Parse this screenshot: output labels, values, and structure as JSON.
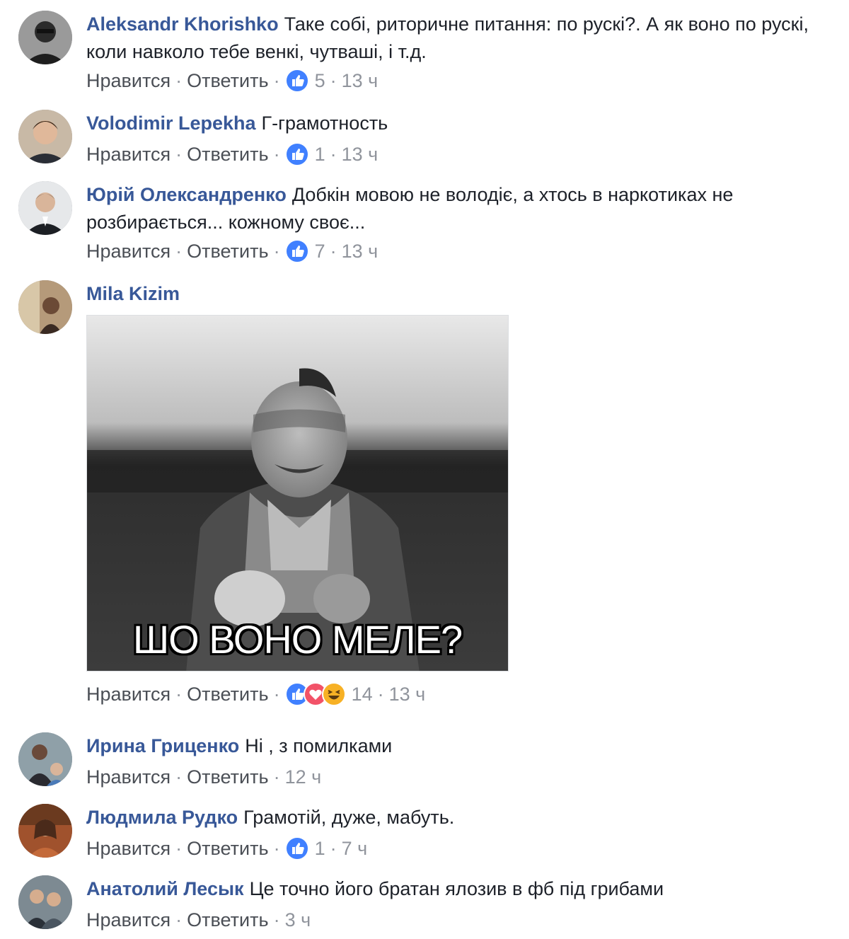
{
  "labels": {
    "like": "Нравится",
    "reply": "Ответить",
    "separator": "·"
  },
  "colors": {
    "author": "#385898",
    "like_blue": "#4080ff",
    "love_red": "#f25268",
    "haha_yellow": "#f7b125",
    "meta_gray": "#90949c"
  },
  "comments": [
    {
      "author": "Aleksandr Khorishko",
      "text": "Таке собі, риторичне питання: по рускі?. А як воно по рускі, коли навколо тебе венкі, чутваші, і т.д.",
      "reactions": [
        "like"
      ],
      "reaction_count": "5",
      "time": "13 ч"
    },
    {
      "author": "Volodimir Lepekha",
      "text": "Г-грамотность",
      "reactions": [
        "like"
      ],
      "reaction_count": "1",
      "time": "13 ч"
    },
    {
      "author": "Юрій Олександренко",
      "text": "Добкін мовою не володіє, а хтось в наркотиках не розбирається... кожному своє...",
      "reactions": [
        "like"
      ],
      "reaction_count": "7",
      "time": "13 ч"
    },
    {
      "author": "Mila Kizim",
      "text": "",
      "image_caption": "ШО ВОНО МЕЛЕ?",
      "reactions": [
        "like",
        "love",
        "haha"
      ],
      "reaction_count": "14",
      "time": "13 ч"
    },
    {
      "author": "Ирина Гриценко",
      "text": "Ні , з помилками",
      "reactions": [],
      "reaction_count": "",
      "time": "12 ч"
    },
    {
      "author": "Людмила Рудко",
      "text": "Грамотій, дуже, мабуть.",
      "reactions": [
        "like"
      ],
      "reaction_count": "1",
      "time": "7 ч"
    },
    {
      "author": "Анатолий Лесык",
      "text": "Це точно його братан ялозив в фб під грибами",
      "reactions": [],
      "reaction_count": "",
      "time": "3 ч"
    }
  ]
}
